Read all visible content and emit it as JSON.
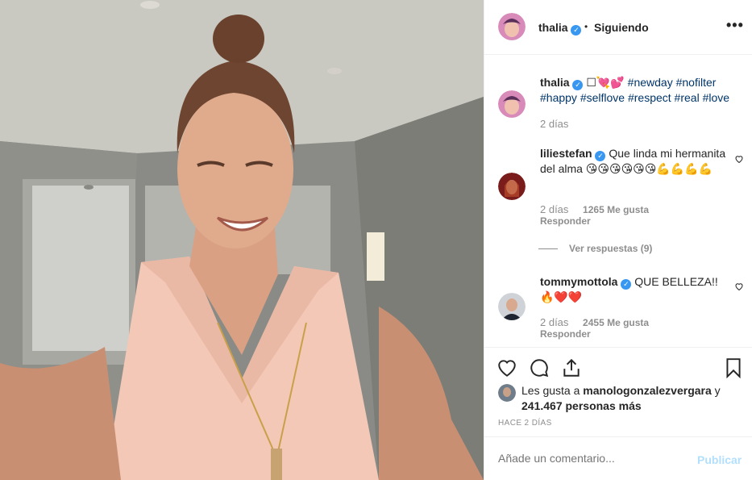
{
  "post": {
    "author": "thalia",
    "follow_status": "Siguiendo",
    "dot": "•",
    "more": "•••"
  },
  "caption": {
    "author": "thalia",
    "emoji": "☐💘💕",
    "hashtags": "#newday #nofilter #happy #selflove #respect #real #love",
    "time": "2 días"
  },
  "comments": [
    {
      "author": "liliestefan",
      "text": "Que linda mi hermanita del alma 😘😘😘😘😘😘💪💪💪💪",
      "time": "2 días",
      "likes": "1265 Me gusta",
      "reply": "Responder"
    },
    {
      "author": "tommymottola",
      "text": "QUE BELLEZA!! 🔥❤️❤️",
      "time": "2 días",
      "likes": "2455 Me gusta",
      "reply": "Responder"
    }
  ],
  "view_replies": "Ver respuestas (9)",
  "liked_by": {
    "prefix": "Les gusta a",
    "user": "manologonzalezvergara",
    "join": "y",
    "count": "241.467 personas más"
  },
  "time_ago": "HACE 2 DÍAS",
  "add_comment": {
    "placeholder": "Añade un comentario...",
    "publish": "Publicar"
  },
  "icons": {
    "like": "heart-icon",
    "comment": "comment-icon",
    "share": "share-icon",
    "save": "bookmark-icon",
    "verified": "verified-badge-icon"
  },
  "colors": {
    "link": "#003569",
    "muted": "#8e8e8e",
    "verified": "#3897f0",
    "publish_disabled": "#b2dffc"
  }
}
